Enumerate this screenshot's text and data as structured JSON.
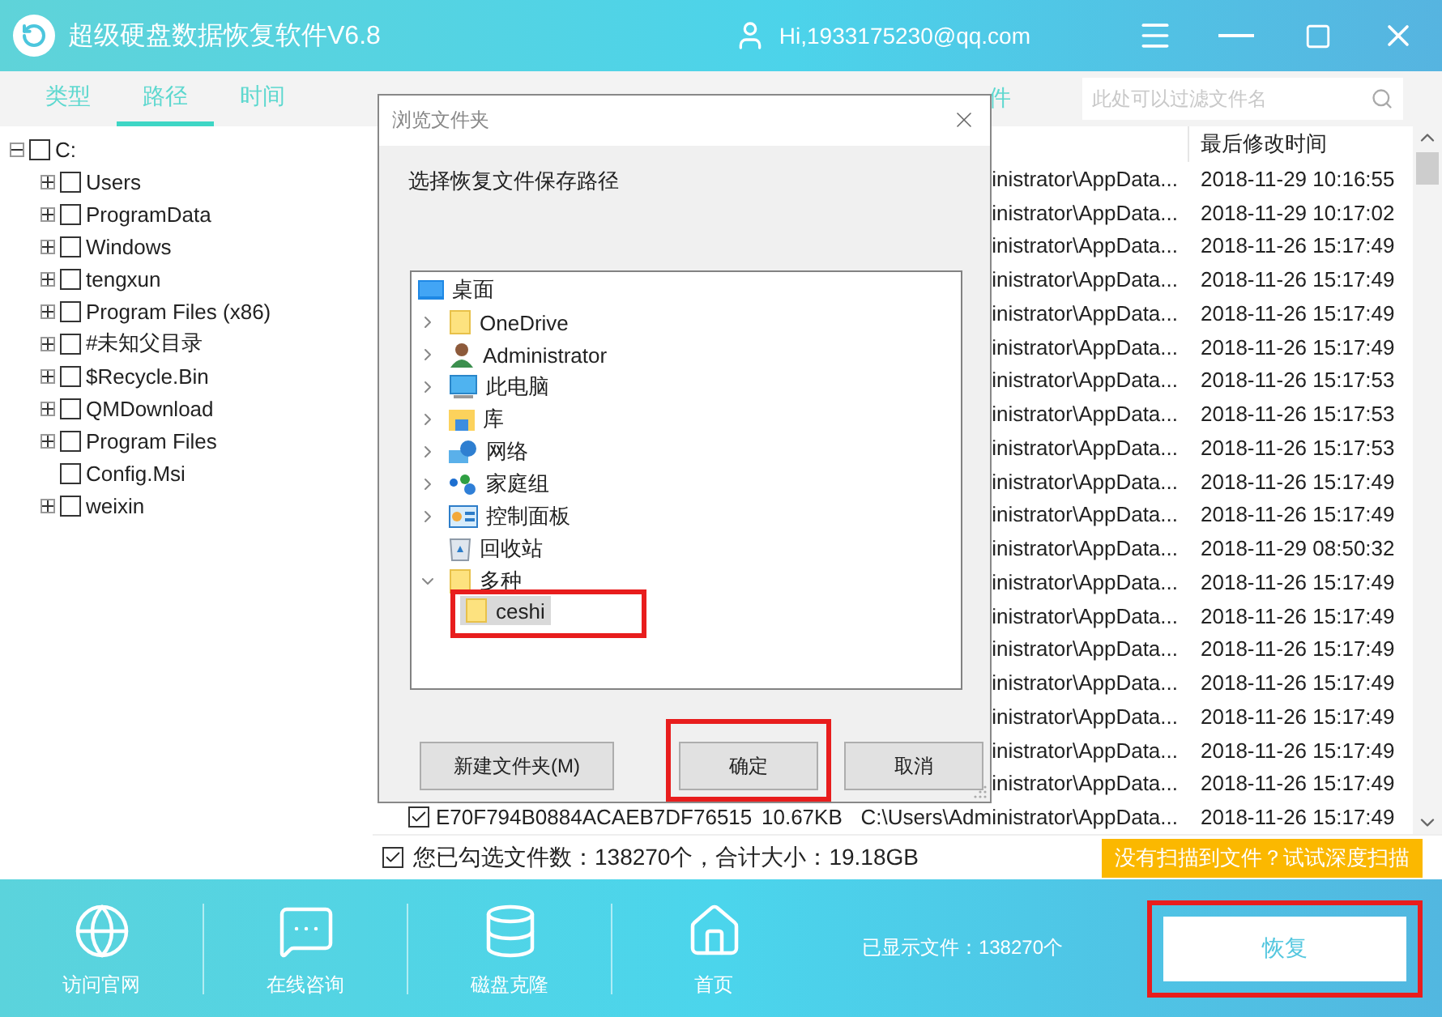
{
  "window": {
    "title": "超级硬盘数据恢复软件V6.8",
    "user": "Hi,1933175230@qq.com"
  },
  "tabs": [
    {
      "label": "类型",
      "selected": false
    },
    {
      "label": "路径",
      "selected": true
    },
    {
      "label": "时间",
      "selected": false
    }
  ],
  "toolbar": {
    "partial_label": "件",
    "search": {
      "placeholder": "此处可以过滤文件名"
    }
  },
  "tree": {
    "label": "C:",
    "expanded": true,
    "checked": false,
    "children": [
      {
        "label": "Users",
        "expandable": true,
        "checked": false
      },
      {
        "label": "ProgramData",
        "expandable": true,
        "checked": false
      },
      {
        "label": "Windows",
        "expandable": true,
        "checked": false
      },
      {
        "label": "tengxun",
        "expandable": true,
        "checked": false
      },
      {
        "label": "Program Files (x86)",
        "expandable": true,
        "checked": false
      },
      {
        "label": "#未知父目录",
        "expandable": true,
        "checked": false
      },
      {
        "label": "$Recycle.Bin",
        "expandable": true,
        "checked": false
      },
      {
        "label": "QMDownload",
        "expandable": true,
        "checked": false
      },
      {
        "label": "Program Files",
        "expandable": true,
        "checked": false
      },
      {
        "label": "Config.Msi",
        "expandable": false,
        "checked": false
      },
      {
        "label": "weixin",
        "expandable": true,
        "checked": false
      }
    ]
  },
  "table": {
    "columns": [
      "最后修改时间"
    ],
    "rows": [
      {
        "path": "inistrator\\AppData...",
        "date": "2018-11-29 10:16:55"
      },
      {
        "path": "inistrator\\AppData...",
        "date": "2018-11-29 10:17:02"
      },
      {
        "path": "inistrator\\AppData...",
        "date": "2018-11-26 15:17:49"
      },
      {
        "path": "inistrator\\AppData...",
        "date": "2018-11-26 15:17:49"
      },
      {
        "path": "inistrator\\AppData...",
        "date": "2018-11-26 15:17:49"
      },
      {
        "path": "inistrator\\AppData...",
        "date": "2018-11-26 15:17:49"
      },
      {
        "path": "inistrator\\AppData...",
        "date": "2018-11-26 15:17:53"
      },
      {
        "path": "inistrator\\AppData...",
        "date": "2018-11-26 15:17:53"
      },
      {
        "path": "inistrator\\AppData...",
        "date": "2018-11-26 15:17:53"
      },
      {
        "path": "inistrator\\AppData...",
        "date": "2018-11-26 15:17:49"
      },
      {
        "path": "inistrator\\AppData...",
        "date": "2018-11-26 15:17:49"
      },
      {
        "path": "inistrator\\AppData...",
        "date": "2018-11-29 08:50:32"
      },
      {
        "path": "inistrator\\AppData...",
        "date": "2018-11-26 15:17:49"
      },
      {
        "path": "inistrator\\AppData...",
        "date": "2018-11-26 15:17:49"
      },
      {
        "path": "inistrator\\AppData...",
        "date": "2018-11-26 15:17:49"
      },
      {
        "path": "inistrator\\AppData...",
        "date": "2018-11-26 15:17:49"
      },
      {
        "path": "inistrator\\AppData...",
        "date": "2018-11-26 15:17:49"
      },
      {
        "path": "inistrator\\AppData...",
        "date": "2018-11-26 15:17:49"
      },
      {
        "path": "inistrator\\AppData...",
        "date": "2018-11-26 15:17:49"
      },
      {
        "checked": true,
        "name": "E70F794B0884ACAEB7DF76515",
        "size": "10.67KB",
        "path": "C:\\Users\\Administrator\\AppData...",
        "date": "2018-11-26 15:17:49"
      }
    ]
  },
  "selection_bar": {
    "checked": true,
    "text": "您已勾选文件数：138270个，合计大小：19.18GB",
    "deep_scan_button": "没有扫描到文件？试试深度扫描"
  },
  "bottom_nav": [
    {
      "label": "访问官网"
    },
    {
      "label": "在线咨询"
    },
    {
      "label": "磁盘克隆"
    },
    {
      "label": "首页"
    }
  ],
  "file_count": "已显示文件：138270个",
  "restore_button": {
    "label": "恢复",
    "highlighted": true
  },
  "dialog": {
    "title": "浏览文件夹",
    "prompt": "选择恢复文件保存路径",
    "root": {
      "label": "桌面",
      "kind": "desktop"
    },
    "folders": [
      {
        "label": "OneDrive",
        "kind": "folder",
        "expandable": true,
        "expanded": false
      },
      {
        "label": "Administrator",
        "kind": "user",
        "expandable": true,
        "expanded": false
      },
      {
        "label": "此电脑",
        "kind": "computer",
        "expandable": true,
        "expanded": false
      },
      {
        "label": "库",
        "kind": "library",
        "expandable": true,
        "expanded": false
      },
      {
        "label": "网络",
        "kind": "network",
        "expandable": true,
        "expanded": false
      },
      {
        "label": "家庭组",
        "kind": "homegroup",
        "expandable": true,
        "expanded": false
      },
      {
        "label": "控制面板",
        "kind": "control",
        "expandable": true,
        "expanded": false
      },
      {
        "label": "回收站",
        "kind": "recycle",
        "expandable": false
      },
      {
        "label": "多种",
        "kind": "folder",
        "expandable": true,
        "expanded": true,
        "children": [
          {
            "label": "ceshi",
            "kind": "folder",
            "selected": true,
            "highlighted": true
          }
        ]
      }
    ],
    "buttons": [
      {
        "label": "新建文件夹(M)",
        "highlighted": false
      },
      {
        "label": "确定",
        "highlighted": true
      },
      {
        "label": "取消",
        "highlighted": false
      }
    ]
  }
}
